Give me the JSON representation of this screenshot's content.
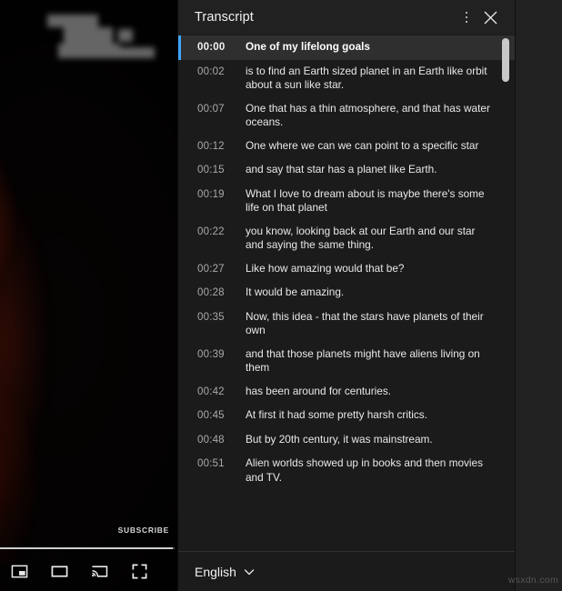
{
  "player": {
    "subscribe_label": "SUBSCRIBE",
    "progress_percent": 99,
    "controls": [
      {
        "name": "miniplayer-icon",
        "label": "Miniplayer"
      },
      {
        "name": "theater-mode-icon",
        "label": "Theater mode"
      },
      {
        "name": "cast-icon",
        "label": "Play on TV"
      },
      {
        "name": "fullscreen-icon",
        "label": "Full screen"
      }
    ]
  },
  "panel": {
    "title": "Transcript",
    "menu_icon": "kebab-menu-icon",
    "close_icon": "close-icon",
    "footer": {
      "language": "English",
      "chevron_icon": "chevron-down-icon"
    }
  },
  "transcript": {
    "active_index": 0,
    "rows": [
      {
        "time": "00:00",
        "text": "One of my lifelong goals"
      },
      {
        "time": "00:02",
        "text": "is to find an Earth sized planet in an Earth like orbit about a sun like star."
      },
      {
        "time": "00:07",
        "text": "One that has a thin atmosphere, and that has water oceans."
      },
      {
        "time": "00:12",
        "text": "One where we can we can point to a specific star"
      },
      {
        "time": "00:15",
        "text": "and say that star has a planet like Earth."
      },
      {
        "time": "00:19",
        "text": "What I love to dream about is maybe there's some life on that planet"
      },
      {
        "time": "00:22",
        "text": "you know, looking back at our Earth and our star and saying the same thing."
      },
      {
        "time": "00:27",
        "text": "Like how amazing would that be?"
      },
      {
        "time": "00:28",
        "text": "It would be amazing."
      },
      {
        "time": "00:35",
        "text": "Now, this idea - that the stars have planets of their own"
      },
      {
        "time": "00:39",
        "text": "and that those planets might have aliens living on them"
      },
      {
        "time": "00:42",
        "text": "has been around for centuries."
      },
      {
        "time": "00:45",
        "text": "At first it had some pretty harsh critics."
      },
      {
        "time": "00:48",
        "text": "But by 20th century, it was mainstream."
      },
      {
        "time": "00:51",
        "text": "Alien worlds showed up in books and then movies and TV."
      }
    ]
  },
  "watermark": {
    "text": "wsxdn.com"
  },
  "colors": {
    "accent": "#3ea6ff",
    "panel_bg": "#1b1b1b",
    "header_bg": "#212121",
    "active_row_bg": "#2f2f2f",
    "text_primary": "#f1f1f1",
    "text_secondary": "#aaaaaa"
  }
}
